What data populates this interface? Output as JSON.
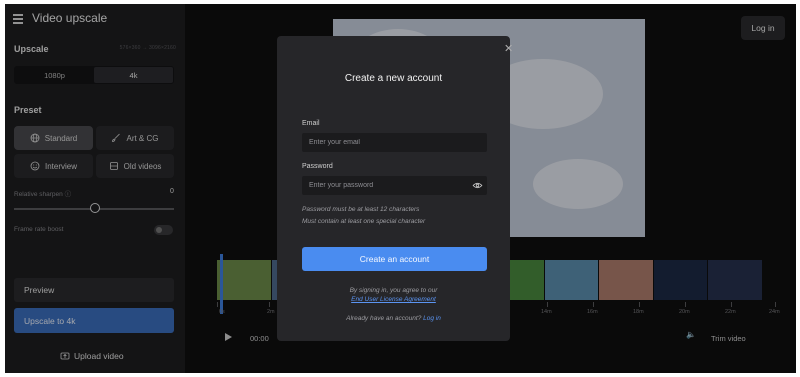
{
  "app": {
    "title": "Video upscale",
    "login_label": "Log in"
  },
  "sidebar": {
    "upscale_label": "Upscale",
    "resolution_note": "576×360 → 3096×2160",
    "resolution_options": [
      "1080p",
      "4k"
    ],
    "resolution_selected": "4k",
    "preset_label": "Preset",
    "presets": [
      "Standard",
      "Art & CG",
      "Interview",
      "Old videos"
    ],
    "preset_selected": "Standard",
    "relative_sharpen_label": "Relative sharpen",
    "relative_sharpen_value": "0",
    "frame_rate_boost_label": "Frame rate boost",
    "preview_label": "Preview",
    "upscale_button_label": "Upscale to 4k",
    "upload_label": "Upload video"
  },
  "player": {
    "time_display": "00:00",
    "ruler_ticks": [
      "0s",
      "2m",
      "14m",
      "16m",
      "18m",
      "20m",
      "22m",
      "24m"
    ],
    "trim_label": "Trim video"
  },
  "modal": {
    "title": "Create a new account",
    "email_label": "Email",
    "email_placeholder": "Enter your email",
    "password_label": "Password",
    "password_placeholder": "Enter your password",
    "hint_line1": "Password must be at least 12 characters",
    "hint_line2": "Must contain at least one special character",
    "create_button": "Create an account",
    "agree_text": "By signing in, you agree to our",
    "agreement_link": "End User License Agreement",
    "have_account_text": "Already have an account?",
    "login_link": "Log in"
  },
  "colors": {
    "accent": "#4a8cf0",
    "upscale_button": "#3c6fbf",
    "panel": "#1e1e20",
    "modal": "#262629"
  }
}
